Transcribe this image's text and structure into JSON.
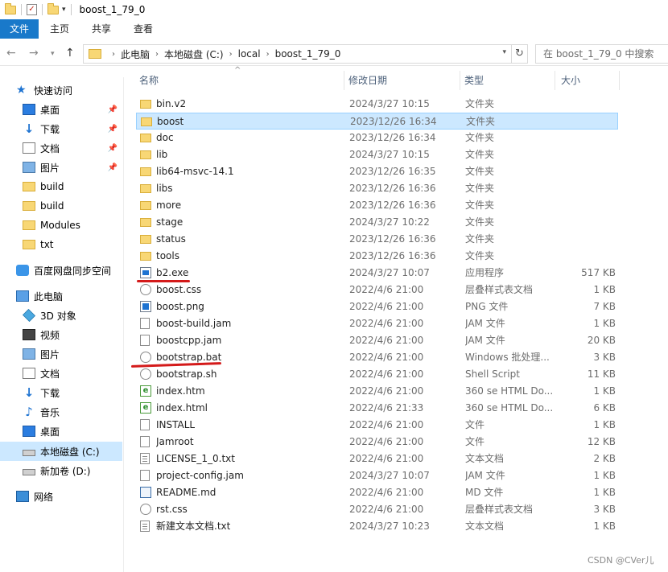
{
  "window": {
    "title": "boost_1_79_0"
  },
  "ribbon": {
    "tabs": [
      "文件",
      "主页",
      "共享",
      "查看"
    ]
  },
  "address": {
    "crumbs": [
      "此电脑",
      "本地磁盘 (C:)",
      "local",
      "boost_1_79_0"
    ]
  },
  "search": {
    "placeholder": "在 boost_1_79_0 中搜索"
  },
  "sidebar": {
    "items": [
      {
        "label": "快速访问",
        "icon": "quick-access-star-icon"
      },
      {
        "label": "桌面",
        "icon": "desktop-icon",
        "pinned": true
      },
      {
        "label": "下载",
        "icon": "download-icon",
        "pinned": true
      },
      {
        "label": "文档",
        "icon": "documents-icon",
        "pinned": true
      },
      {
        "label": "图片",
        "icon": "pictures-icon",
        "pinned": true
      },
      {
        "label": "build",
        "icon": "folder-icon"
      },
      {
        "label": "build",
        "icon": "folder-icon"
      },
      {
        "label": "Modules",
        "icon": "folder-icon"
      },
      {
        "label": "txt",
        "icon": "folder-icon"
      },
      {
        "label": "百度网盘同步空间",
        "icon": "baidu-cloud-icon"
      },
      {
        "label": "此电脑",
        "icon": "this-pc-icon"
      },
      {
        "label": "3D 对象",
        "icon": "3d-objects-icon"
      },
      {
        "label": "视频",
        "icon": "videos-icon"
      },
      {
        "label": "图片",
        "icon": "pictures-icon"
      },
      {
        "label": "文档",
        "icon": "documents-icon"
      },
      {
        "label": "下载",
        "icon": "download-icon"
      },
      {
        "label": "音乐",
        "icon": "music-icon"
      },
      {
        "label": "桌面",
        "icon": "desktop-icon"
      },
      {
        "label": "本地磁盘 (C:)",
        "icon": "drive-icon",
        "selected": true
      },
      {
        "label": "新加卷 (D:)",
        "icon": "drive-icon"
      },
      {
        "label": "网络",
        "icon": "network-icon"
      }
    ]
  },
  "columns": {
    "name": "名称",
    "date": "修改日期",
    "type": "类型",
    "size": "大小"
  },
  "files": [
    {
      "name": "bin.v2",
      "date": "2024/3/27 10:15",
      "type": "文件夹",
      "size": "",
      "icon": "folder-icon"
    },
    {
      "name": "boost",
      "date": "2023/12/26 16:34",
      "type": "文件夹",
      "size": "",
      "icon": "folder-icon",
      "selected": true
    },
    {
      "name": "doc",
      "date": "2023/12/26 16:34",
      "type": "文件夹",
      "size": "",
      "icon": "folder-icon"
    },
    {
      "name": "lib",
      "date": "2024/3/27 10:15",
      "type": "文件夹",
      "size": "",
      "icon": "folder-icon"
    },
    {
      "name": "lib64-msvc-14.1",
      "date": "2023/12/26 16:35",
      "type": "文件夹",
      "size": "",
      "icon": "folder-icon"
    },
    {
      "name": "libs",
      "date": "2023/12/26 16:36",
      "type": "文件夹",
      "size": "",
      "icon": "folder-icon"
    },
    {
      "name": "more",
      "date": "2023/12/26 16:36",
      "type": "文件夹",
      "size": "",
      "icon": "folder-icon"
    },
    {
      "name": "stage",
      "date": "2024/3/27 10:22",
      "type": "文件夹",
      "size": "",
      "icon": "folder-icon"
    },
    {
      "name": "status",
      "date": "2023/12/26 16:36",
      "type": "文件夹",
      "size": "",
      "icon": "folder-icon"
    },
    {
      "name": "tools",
      "date": "2023/12/26 16:36",
      "type": "文件夹",
      "size": "",
      "icon": "folder-icon"
    },
    {
      "name": "b2.exe",
      "date": "2024/3/27 10:07",
      "type": "应用程序",
      "size": "517 KB",
      "icon": "exe-icon"
    },
    {
      "name": "boost.css",
      "date": "2022/4/6 21:00",
      "type": "层叠样式表文档",
      "size": "1 KB",
      "icon": "css-file-icon"
    },
    {
      "name": "boost.png",
      "date": "2022/4/6 21:00",
      "type": "PNG 文件",
      "size": "7 KB",
      "icon": "png-file-icon"
    },
    {
      "name": "boost-build.jam",
      "date": "2022/4/6 21:00",
      "type": "JAM 文件",
      "size": "1 KB",
      "icon": "file-icon"
    },
    {
      "name": "boostcpp.jam",
      "date": "2022/4/6 21:00",
      "type": "JAM 文件",
      "size": "20 KB",
      "icon": "file-icon"
    },
    {
      "name": "bootstrap.bat",
      "date": "2022/4/6 21:00",
      "type": "Windows 批处理...",
      "size": "3 KB",
      "icon": "bat-file-icon"
    },
    {
      "name": "bootstrap.sh",
      "date": "2022/4/6 21:00",
      "type": "Shell Script",
      "size": "11 KB",
      "icon": "sh-file-icon"
    },
    {
      "name": "index.htm",
      "date": "2022/4/6 21:00",
      "type": "360 se HTML Do...",
      "size": "1 KB",
      "icon": "html-file-icon"
    },
    {
      "name": "index.html",
      "date": "2022/4/6 21:33",
      "type": "360 se HTML Do...",
      "size": "6 KB",
      "icon": "html-file-icon"
    },
    {
      "name": "INSTALL",
      "date": "2022/4/6 21:00",
      "type": "文件",
      "size": "1 KB",
      "icon": "file-icon"
    },
    {
      "name": "Jamroot",
      "date": "2022/4/6 21:00",
      "type": "文件",
      "size": "12 KB",
      "icon": "file-icon"
    },
    {
      "name": "LICENSE_1_0.txt",
      "date": "2022/4/6 21:00",
      "type": "文本文档",
      "size": "2 KB",
      "icon": "text-file-icon"
    },
    {
      "name": "project-config.jam",
      "date": "2024/3/27 10:07",
      "type": "JAM 文件",
      "size": "1 KB",
      "icon": "file-icon"
    },
    {
      "name": "README.md",
      "date": "2022/4/6 21:00",
      "type": "MD 文件",
      "size": "1 KB",
      "icon": "md-file-icon"
    },
    {
      "name": "rst.css",
      "date": "2022/4/6 21:00",
      "type": "层叠样式表文档",
      "size": "3 KB",
      "icon": "css-file-icon"
    },
    {
      "name": "新建文本文档.txt",
      "date": "2024/3/27 10:23",
      "type": "文本文档",
      "size": "1 KB",
      "icon": "text-file-icon"
    }
  ],
  "watermark": "CSDN @CVer儿",
  "colors": {
    "accent": "#1979ca",
    "selection": "#cce8ff",
    "annotation": "#d41a1a"
  }
}
